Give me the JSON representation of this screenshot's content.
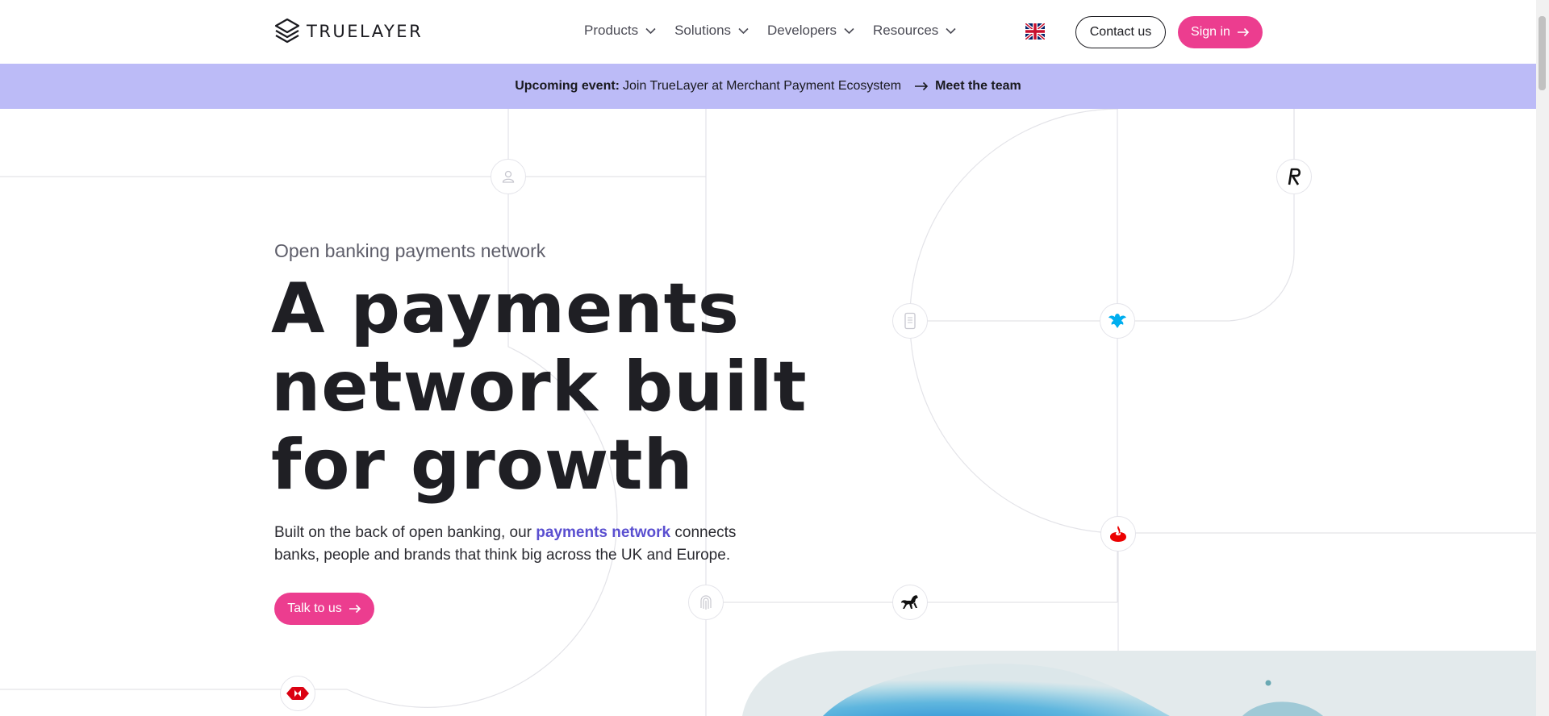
{
  "brand": {
    "name": "TRUELAYER"
  },
  "nav": {
    "items": [
      {
        "label": "Products"
      },
      {
        "label": "Solutions"
      },
      {
        "label": "Developers"
      },
      {
        "label": "Resources"
      }
    ],
    "language_icon": "uk-flag-icon",
    "contact_label": "Contact us",
    "signin_label": "Sign in"
  },
  "banner": {
    "prefix": "Upcoming event:",
    "message": "Join TrueLayer at Merchant Payment Ecosystem",
    "cta": "Meet the team"
  },
  "hero": {
    "eyebrow": "Open banking payments network",
    "headline_lines": [
      "A payments",
      "network built",
      "for growth"
    ],
    "body_before": "Built on the back of open banking, our ",
    "body_link": "payments network",
    "body_after": " connects banks, people and brands that think big across the UK and Europe.",
    "cta_label": "Talk to us"
  },
  "network_icons": [
    "user-icon",
    "revolut-icon",
    "phone-icon",
    "barclays-eagle-icon",
    "santander-flame-icon",
    "fingerprint-icon",
    "lloyds-horse-icon",
    "hsbc-hexagon-icon"
  ],
  "colors": {
    "accent": "#ec3d8f",
    "banner": "#bcbbf7",
    "link": "#5a4fd0"
  }
}
